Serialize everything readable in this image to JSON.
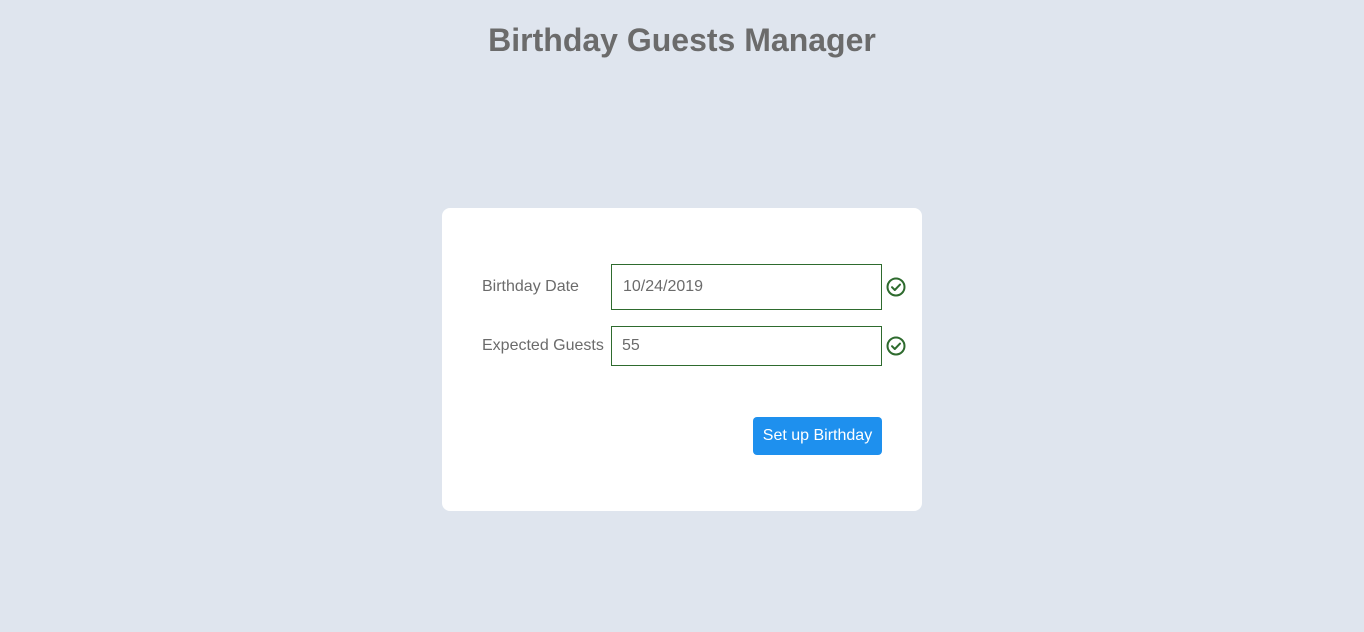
{
  "header": {
    "title": "Birthday Guests Manager"
  },
  "form": {
    "birthday_date": {
      "label": "Birthday Date",
      "value": "10/24/2019",
      "status_icon": "check-circle-icon"
    },
    "expected_guests": {
      "label": "Expected Guests",
      "value": "55",
      "status_icon": "check-circle-icon"
    },
    "submit_label": "Set up Birthday"
  },
  "colors": {
    "background": "#dfe5ee",
    "valid": "#2e6b2e",
    "primary_button": "#1e90ee"
  }
}
